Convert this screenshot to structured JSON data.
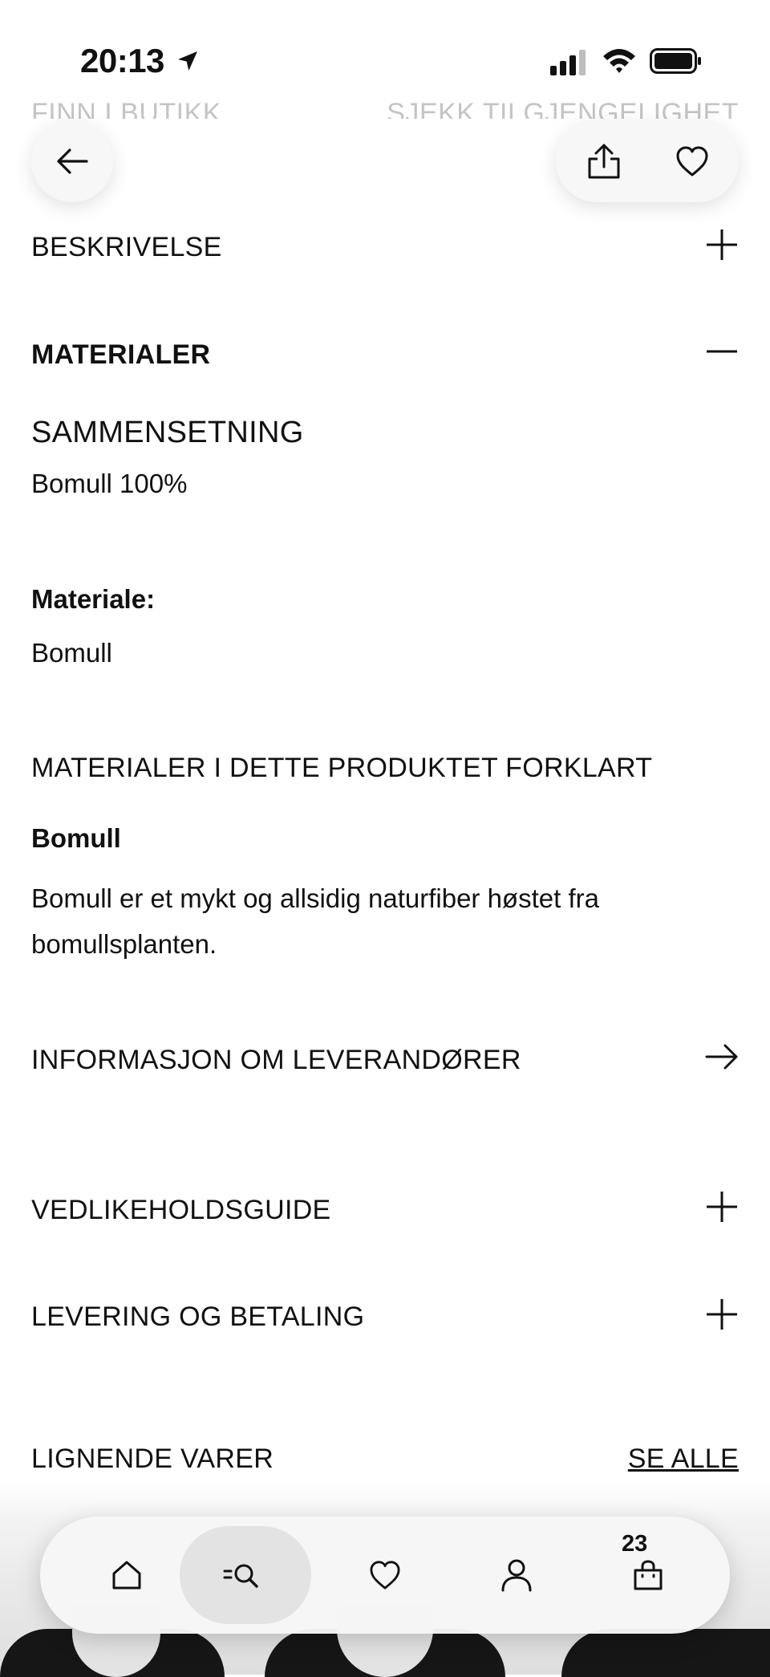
{
  "status_bar": {
    "time": "20:13",
    "location_icon": "location-arrow-icon",
    "signal_icon": "cellular-signal-icon",
    "wifi_icon": "wifi-icon",
    "battery_icon": "battery-icon"
  },
  "top_row": {
    "find_in_store": "FINN I BUTIKK",
    "check_availability": "SJEKK TILGJENGELIGHET"
  },
  "header_buttons": {
    "back_icon": "arrow-left-icon",
    "share_icon": "share-icon",
    "favorite_icon": "heart-icon"
  },
  "sections": {
    "description": {
      "title": "BESKRIVELSE",
      "state": "collapsed",
      "icon": "plus-icon"
    },
    "materials": {
      "title": "MATERIALER",
      "state": "expanded",
      "icon": "minus-icon",
      "composition_label": "SAMMENSETNING",
      "composition_value": "Bomull 100%",
      "material_label": "Materiale:",
      "material_value": "Bomull",
      "explained_title": "MATERIALER I DETTE PRODUKTET FORKLART",
      "explained_name": "Bomull",
      "explained_text": "Bomull er et mykt og allsidig naturfiber høstet fra bomullsplanten."
    },
    "supplier_info": {
      "title": "INFORMASJON OM LEVERANDØRER",
      "icon": "arrow-right-icon"
    },
    "care_guide": {
      "title": "VEDLIKEHOLDSGUIDE",
      "state": "collapsed",
      "icon": "plus-icon"
    },
    "delivery": {
      "title": "LEVERING OG BETALING",
      "state": "collapsed",
      "icon": "plus-icon"
    }
  },
  "similar": {
    "title": "LIGNENDE VARER",
    "see_all": "SE ALLE"
  },
  "tab_bar": {
    "active": "search",
    "tabs": [
      {
        "id": "home",
        "icon": "home-icon"
      },
      {
        "id": "search",
        "icon": "search-menu-icon"
      },
      {
        "id": "favorites",
        "icon": "heart-icon"
      },
      {
        "id": "account",
        "icon": "person-icon"
      },
      {
        "id": "cart",
        "icon": "shopping-bag-icon"
      }
    ],
    "cart_count": "23"
  },
  "colors": {
    "text": "#111111",
    "faded_text": "#c4c4c4",
    "button_bg": "#f7f7f7",
    "tab_active_bg": "#e3e3e3"
  }
}
